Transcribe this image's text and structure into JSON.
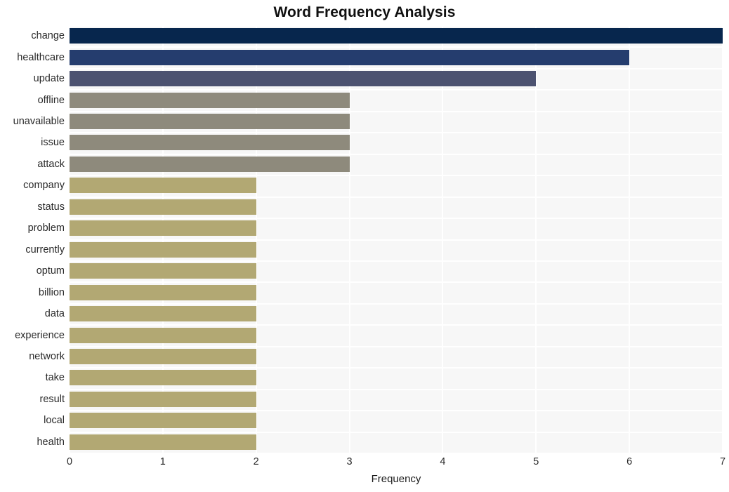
{
  "chart_data": {
    "type": "bar",
    "orientation": "horizontal",
    "title": "Word Frequency Analysis",
    "xlabel": "Frequency",
    "ylabel": "",
    "xlim": [
      0,
      7
    ],
    "ylim": [
      0,
      20
    ],
    "grid": true,
    "legend": false,
    "categories": [
      "change",
      "healthcare",
      "update",
      "offline",
      "unavailable",
      "issue",
      "attack",
      "company",
      "status",
      "problem",
      "currently",
      "optum",
      "billion",
      "data",
      "experience",
      "network",
      "take",
      "result",
      "local",
      "health"
    ],
    "values": [
      7,
      6,
      5,
      3,
      3,
      3,
      3,
      2,
      2,
      2,
      2,
      2,
      2,
      2,
      2,
      2,
      2,
      2,
      2,
      2
    ],
    "bar_colors": [
      "#07264d",
      "#253d6e",
      "#4c5270",
      "#8e8a7c",
      "#8e8a7c",
      "#8e8a7c",
      "#8e8a7c",
      "#b2a873",
      "#b2a873",
      "#b2a873",
      "#b2a873",
      "#b2a873",
      "#b2a873",
      "#b2a873",
      "#b2a873",
      "#b2a873",
      "#b2a873",
      "#b2a873",
      "#b2a873",
      "#b2a873"
    ],
    "x_ticks": [
      0,
      1,
      2,
      3,
      4,
      5,
      6,
      7
    ],
    "x_tick_labels": [
      "0",
      "1",
      "2",
      "3",
      "4",
      "5",
      "6",
      "7"
    ],
    "plot_background_color": "#f7f7f7",
    "gridline_color": "#ffffff",
    "figure_background_color": "#ffffff",
    "title_color": "#101010",
    "tick_label_color": "#2a2a2a"
  }
}
